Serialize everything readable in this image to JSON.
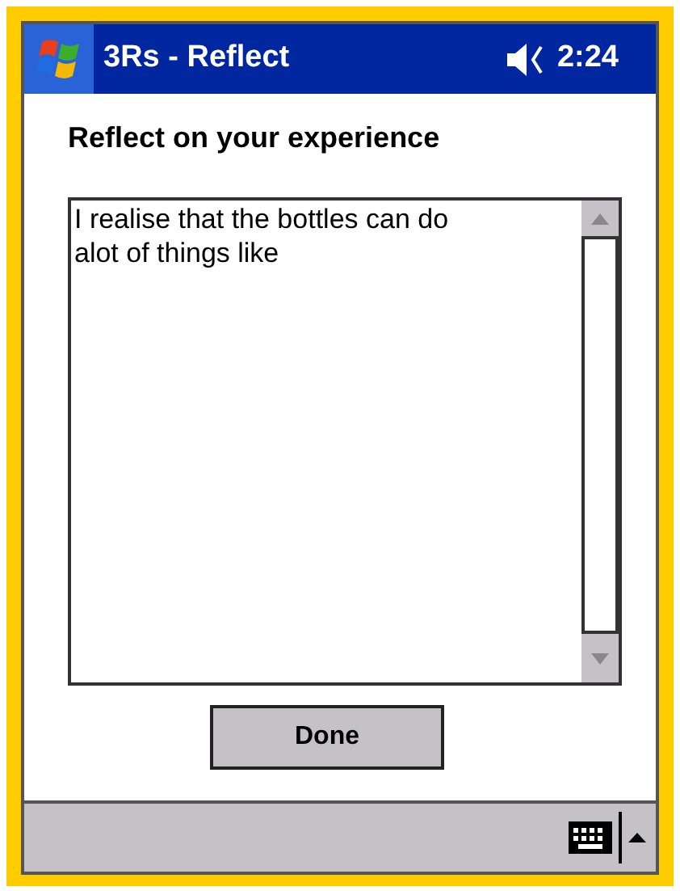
{
  "title_bar": {
    "title": "3Rs - Reflect",
    "time": "2:24"
  },
  "heading": "Reflect on your experience",
  "reflection_field": {
    "value": "I realise that the bottles can do alot of things like"
  },
  "buttons": [
    {
      "label": "Done"
    }
  ]
}
